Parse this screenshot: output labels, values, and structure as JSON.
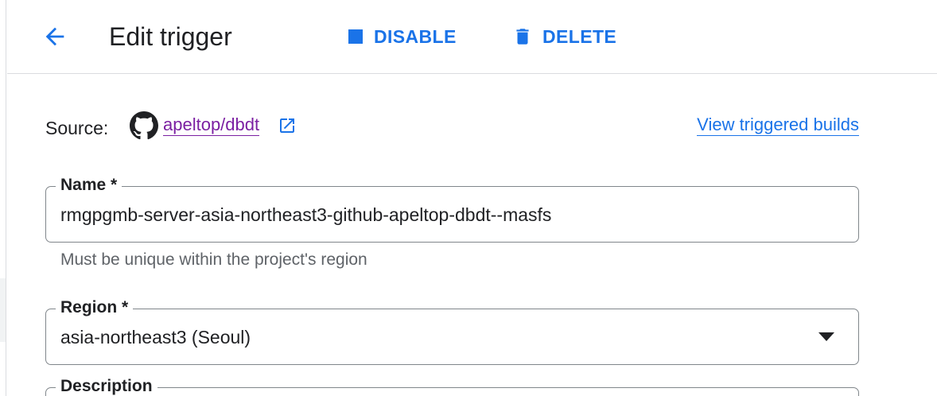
{
  "header": {
    "title": "Edit trigger",
    "disable_label": "DISABLE",
    "delete_label": "DELETE"
  },
  "source": {
    "label": "Source:",
    "repo": "apeltop/dbdt",
    "view_builds_label": "View triggered builds"
  },
  "name_field": {
    "label": "Name *",
    "value": "rmgpgmb-server-asia-northeast3-github-apeltop-dbdt--masfs",
    "hint": "Must be unique within the project's region"
  },
  "region_field": {
    "label": "Region *",
    "value": "asia-northeast3 (Seoul)"
  },
  "description_field": {
    "label": "Description"
  },
  "colors": {
    "accent": "#1a73e8",
    "visited_link": "#7b1fa2",
    "text": "#202124",
    "hint": "#5f6368",
    "border": "#80868b",
    "divider": "#dadce0"
  },
  "icons": {
    "back": "arrow-left-icon",
    "disable": "stop-square-icon",
    "delete": "trash-icon",
    "source": "github-icon",
    "external": "open-in-new-icon",
    "dropdown": "caret-down-icon"
  }
}
